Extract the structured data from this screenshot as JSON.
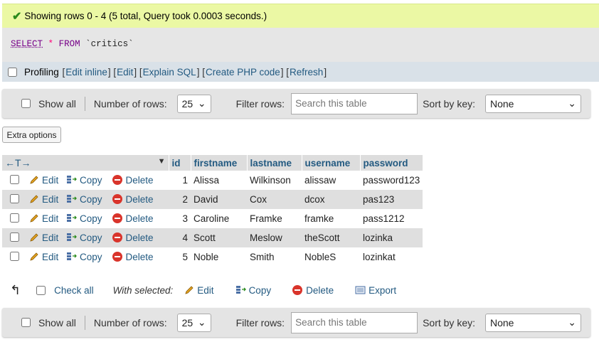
{
  "success": {
    "message": "Showing rows 0 - 4 (5 total, Query took 0.0003 seconds.)"
  },
  "sql": {
    "select": "SELECT",
    "star": "*",
    "from": "FROM",
    "table": "`critics`"
  },
  "profiling": {
    "label": "Profiling",
    "links": [
      "Edit inline",
      "Edit",
      "Explain SQL",
      "Create PHP code",
      "Refresh"
    ]
  },
  "nav": {
    "show_all": "Show all",
    "rows_label": "Number of rows:",
    "rows_value": "25",
    "filter_label": "Filter rows:",
    "filter_placeholder": "Search this table",
    "sort_label": "Sort by key:",
    "sort_value": "None"
  },
  "extra_options": "Extra options",
  "table": {
    "sort_arrows": "←T→",
    "columns": [
      "id",
      "firstname",
      "lastname",
      "username",
      "password"
    ],
    "actions": {
      "edit": "Edit",
      "copy": "Copy",
      "delete": "Delete"
    },
    "rows": [
      {
        "id": "1",
        "firstname": "Alissa",
        "lastname": "Wilkinson",
        "username": "alissaw",
        "password": "password123"
      },
      {
        "id": "2",
        "firstname": "David",
        "lastname": "Cox",
        "username": "dcox",
        "password": "pas123"
      },
      {
        "id": "3",
        "firstname": "Caroline",
        "lastname": "Framke",
        "username": "framke",
        "password": "pass1212"
      },
      {
        "id": "4",
        "firstname": "Scott",
        "lastname": "Meslow",
        "username": "theScott",
        "password": "lozinka"
      },
      {
        "id": "5",
        "firstname": "Noble",
        "lastname": "Smith",
        "username": "NobleS",
        "password": "lozinkat"
      }
    ]
  },
  "bulk": {
    "check_all": "Check all",
    "with_selected": "With selected:",
    "edit": "Edit",
    "copy": "Copy",
    "delete": "Delete",
    "export": "Export"
  }
}
